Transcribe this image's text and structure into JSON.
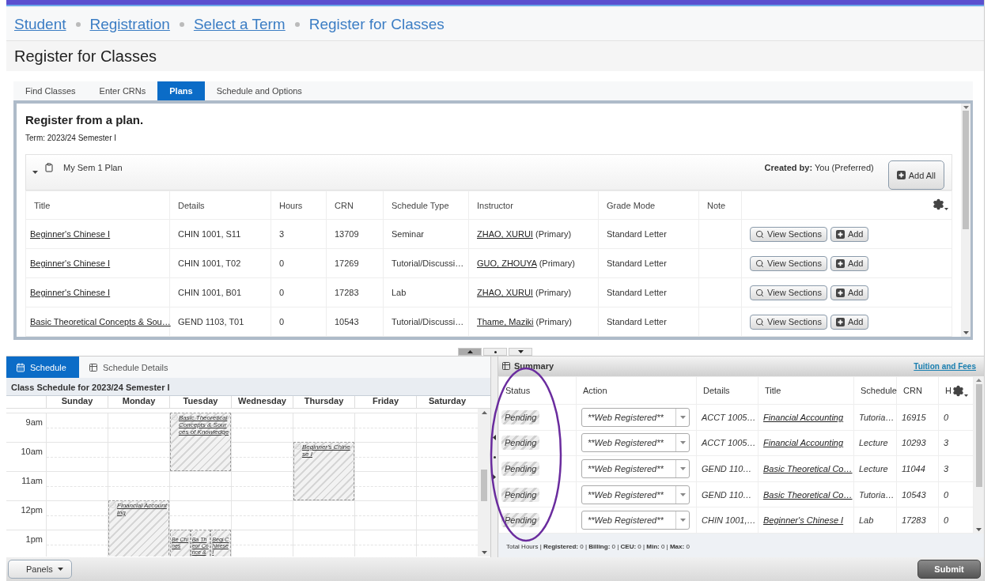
{
  "breadcrumb": [
    {
      "label": "Student",
      "link": true
    },
    {
      "label": "Registration",
      "link": true
    },
    {
      "label": "Select a Term",
      "link": true
    },
    {
      "label": "Register for Classes",
      "link": false
    }
  ],
  "page_title": "Register for Classes",
  "tabs": [
    {
      "label": "Find Classes",
      "selected": false
    },
    {
      "label": "Enter CRNs",
      "selected": false
    },
    {
      "label": "Plans",
      "selected": true
    },
    {
      "label": "Schedule and Options",
      "selected": false
    }
  ],
  "plan_panel": {
    "heading": "Register from a plan.",
    "term": "Term: 2023/24 Semester I",
    "plan_name": "My Sem 1 Plan",
    "created_by_label": "Created by:",
    "created_by_value": "You (Preferred)",
    "add_all": "Add All",
    "columns": [
      "Title",
      "Details",
      "Hours",
      "CRN",
      "Schedule Type",
      "Instructor",
      "Grade Mode",
      "Note"
    ],
    "rows": [
      {
        "title": "Beginner's Chinese I",
        "details": "CHIN 1001, S11",
        "hours": "3",
        "crn": "13709",
        "schedule_type": "Seminar",
        "instructor": "ZHAO, XURUI",
        "role": "(Primary)",
        "grade_mode": "Standard Letter",
        "view": "View Sections",
        "add": "Add"
      },
      {
        "title": "Beginner's Chinese I",
        "details": "CHIN 1001, T02",
        "hours": "0",
        "crn": "17269",
        "schedule_type": "Tutorial/Discussi…",
        "instructor": "GUO, ZHOUYA",
        "role": "(Primary)",
        "grade_mode": "Standard Letter",
        "view": "View Sections",
        "add": "Add"
      },
      {
        "title": "Beginner's Chinese I",
        "details": "CHIN 1001, B01",
        "hours": "0",
        "crn": "17283",
        "schedule_type": "Lab",
        "instructor": "ZHAO, XURUI",
        "role": "(Primary)",
        "grade_mode": "Standard Letter",
        "view": "View Sections",
        "add": "Add"
      },
      {
        "title": "Basic Theoretical Concepts & Sou…",
        "details": "GEND 1103, T01",
        "hours": "0",
        "crn": "10543",
        "schedule_type": "Tutorial/Discussi…",
        "instructor": "Thame, Maziki",
        "role": "(Primary)",
        "grade_mode": "Standard Letter",
        "view": "View Sections",
        "add": "Add"
      }
    ]
  },
  "schedule_panel": {
    "tabs": [
      {
        "label": "Schedule",
        "selected": true
      },
      {
        "label": "Schedule Details",
        "selected": false
      }
    ],
    "caption": "Class Schedule for 2023/24 Semester I",
    "days": [
      {
        "name": "Sunday"
      },
      {
        "name": "Monday"
      },
      {
        "name": "Tuesday"
      },
      {
        "name": "Wednesday"
      },
      {
        "name": "Thursday"
      },
      {
        "name": "Friday"
      },
      {
        "name": "Saturday"
      }
    ],
    "hours": [
      {
        "label": "9am",
        "cells": [
          {},
          {},
          {
            "events": [
              {
                "title": "Basic Theoretical Concepts & Sources of Knowledge"
              }
            ]
          },
          {},
          {},
          {},
          {}
        ]
      },
      {
        "label": "10am",
        "cells": [
          {},
          {},
          {},
          {},
          {
            "events": [
              {
                "title": "Beginner's Chinese I"
              }
            ]
          },
          {},
          {}
        ]
      },
      {
        "label": "11am",
        "cells": [
          {},
          {},
          {},
          {},
          {},
          {},
          {}
        ]
      },
      {
        "label": "12pm",
        "cells": [
          {},
          {
            "events": [
              {
                "title": "Financial Accounting"
              }
            ]
          },
          {},
          {},
          {},
          {},
          {}
        ]
      },
      {
        "label": "1pm",
        "cells": [
          {},
          {},
          {
            "events": [
              {
                "title": "Be Chines"
              },
              {
                "title": "Ba Theor Conce &"
              },
              {
                "title": "Begi Chinese I"
              }
            ]
          },
          {},
          {},
          {},
          {}
        ]
      }
    ]
  },
  "summary_panel": {
    "title": "Summary",
    "link": "Tuition and Fees",
    "columns": [
      "Status",
      "Action",
      "Details",
      "Title",
      "Schedule",
      "CRN",
      "H"
    ],
    "rows": [
      {
        "status": "Pending",
        "action": "**Web Registered**",
        "details": "ACCT 1005…",
        "title": "Financial Accounting",
        "schedule": "Tutoria…",
        "crn": "16915",
        "hours": "0"
      },
      {
        "status": "Pending",
        "action": "**Web Registered**",
        "details": "ACCT 1005…",
        "title": "Financial Accounting",
        "schedule": "Lecture",
        "crn": "10293",
        "hours": "3"
      },
      {
        "status": "Pending",
        "action": "**Web Registered**",
        "details": "GEND 110…",
        "title": "Basic Theoretical Co…",
        "schedule": "Lecture",
        "crn": "11044",
        "hours": "3"
      },
      {
        "status": "Pending",
        "action": "**Web Registered**",
        "details": "GEND 110…",
        "title": "Basic Theoretical Co…",
        "schedule": "Tutoria…",
        "crn": "10543",
        "hours": "0"
      },
      {
        "status": "Pending",
        "action": "**Web Registered**",
        "details": "CHIN 1001,…",
        "title": "Beginner's Chinese I",
        "schedule": "Lab",
        "crn": "17283",
        "hours": "0"
      }
    ],
    "totals": "Total Hours | **Registered:** 0 | **Billing:** 0 | **CEU:** 0 | **Min:** 0 | **Max:** 0"
  },
  "footer": {
    "panels": "Panels",
    "submit": "Submit"
  }
}
